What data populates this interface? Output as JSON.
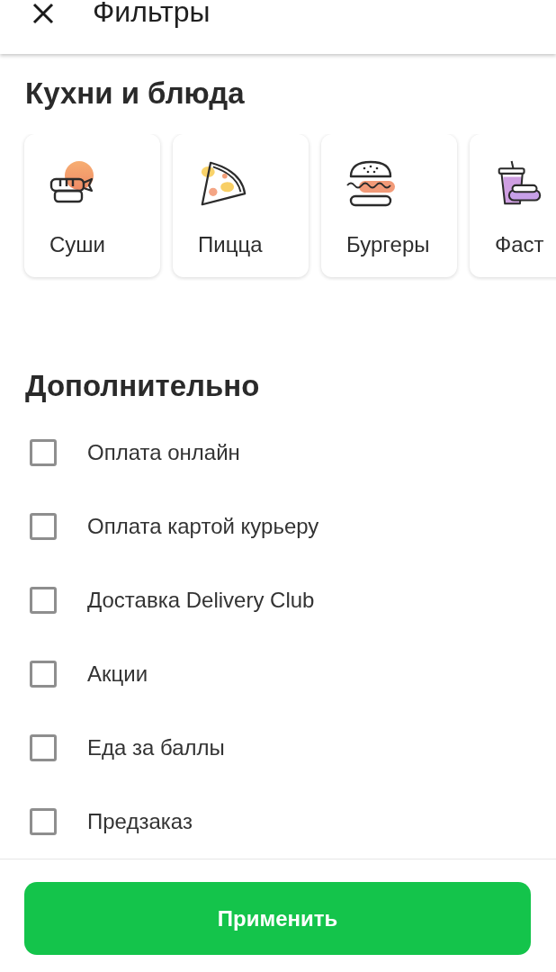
{
  "header": {
    "title": "Фильтры"
  },
  "cuisines": {
    "title": "Кухни и блюда",
    "items": [
      {
        "label": "Суши",
        "kind": "sushi"
      },
      {
        "label": "Пицца",
        "kind": "pizza"
      },
      {
        "label": "Бургеры",
        "kind": "burger"
      },
      {
        "label": "Фаст",
        "kind": "fastfood"
      }
    ]
  },
  "extras": {
    "title": "Дополнительно",
    "options": [
      {
        "label": "Оплата онлайн",
        "checked": false
      },
      {
        "label": "Оплата картой курьеру",
        "checked": false
      },
      {
        "label": "Доставка Delivery Club",
        "checked": false
      },
      {
        "label": "Акции",
        "checked": false
      },
      {
        "label": "Еда за баллы",
        "checked": false
      },
      {
        "label": "Предзаказ",
        "checked": false
      }
    ]
  },
  "apply_button": {
    "label": "Применить"
  }
}
